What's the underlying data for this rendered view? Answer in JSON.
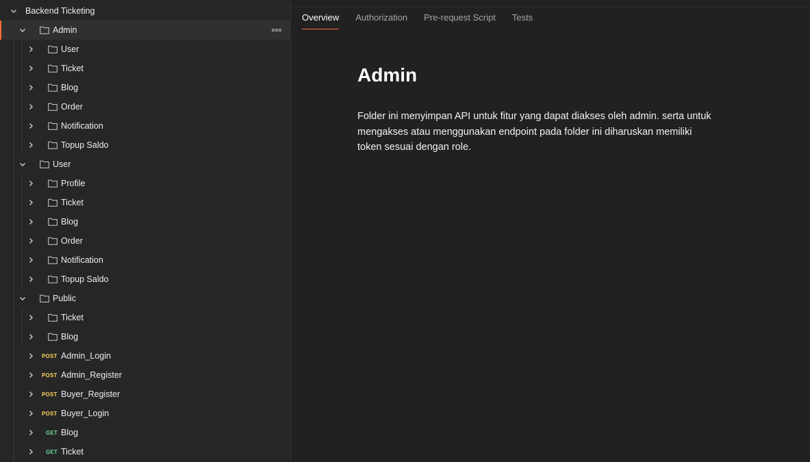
{
  "sidebar": {
    "root": {
      "label": "Backend Ticketing",
      "expanded": true
    },
    "tree": [
      {
        "type": "folder",
        "label": "Admin",
        "level": 1,
        "expanded": true,
        "selected": true
      },
      {
        "type": "folder",
        "label": "User",
        "level": 2,
        "expanded": false
      },
      {
        "type": "folder",
        "label": "Ticket",
        "level": 2,
        "expanded": false
      },
      {
        "type": "folder",
        "label": "Blog",
        "level": 2,
        "expanded": false
      },
      {
        "type": "folder",
        "label": "Order",
        "level": 2,
        "expanded": false
      },
      {
        "type": "folder",
        "label": "Notification",
        "level": 2,
        "expanded": false
      },
      {
        "type": "folder",
        "label": "Topup Saldo",
        "level": 2,
        "expanded": false
      },
      {
        "type": "folder",
        "label": "User",
        "level": 1,
        "expanded": true
      },
      {
        "type": "folder",
        "label": "Profile",
        "level": 2,
        "expanded": false
      },
      {
        "type": "folder",
        "label": "Ticket",
        "level": 2,
        "expanded": false
      },
      {
        "type": "folder",
        "label": "Blog",
        "level": 2,
        "expanded": false
      },
      {
        "type": "folder",
        "label": "Order",
        "level": 2,
        "expanded": false
      },
      {
        "type": "folder",
        "label": "Notification",
        "level": 2,
        "expanded": false
      },
      {
        "type": "folder",
        "label": "Topup Saldo",
        "level": 2,
        "expanded": false
      },
      {
        "type": "folder",
        "label": "Public",
        "level": 1,
        "expanded": true
      },
      {
        "type": "folder",
        "label": "Ticket",
        "level": 2,
        "expanded": false
      },
      {
        "type": "folder",
        "label": "Blog",
        "level": 2,
        "expanded": false
      },
      {
        "type": "request",
        "method": "POST",
        "label": "Admin_Login",
        "level": 1
      },
      {
        "type": "request",
        "method": "POST",
        "label": "Admin_Register",
        "level": 1
      },
      {
        "type": "request",
        "method": "POST",
        "label": "Buyer_Register",
        "level": 1
      },
      {
        "type": "request",
        "method": "POST",
        "label": "Buyer_Login",
        "level": 1
      },
      {
        "type": "request",
        "method": "GET",
        "label": "Blog",
        "level": 1
      },
      {
        "type": "request",
        "method": "GET",
        "label": "Ticket",
        "level": 1
      }
    ],
    "more_icon": "ellipsis-icon"
  },
  "main": {
    "tabs": [
      {
        "label": "Overview",
        "active": true
      },
      {
        "label": "Authorization",
        "active": false
      },
      {
        "label": "Pre-request Script",
        "active": false
      },
      {
        "label": "Tests",
        "active": false
      }
    ],
    "title": "Admin",
    "description": "Folder ini menyimpan API untuk fitur yang dapat diakses oleh admin. serta untuk mengakses atau menggunakan endpoint pada folder ini diharuskan memiliki token sesuai dengan role."
  },
  "colors": {
    "accent": "#ff6c37",
    "post": "#ffd35c",
    "get": "#6bdd9a"
  }
}
